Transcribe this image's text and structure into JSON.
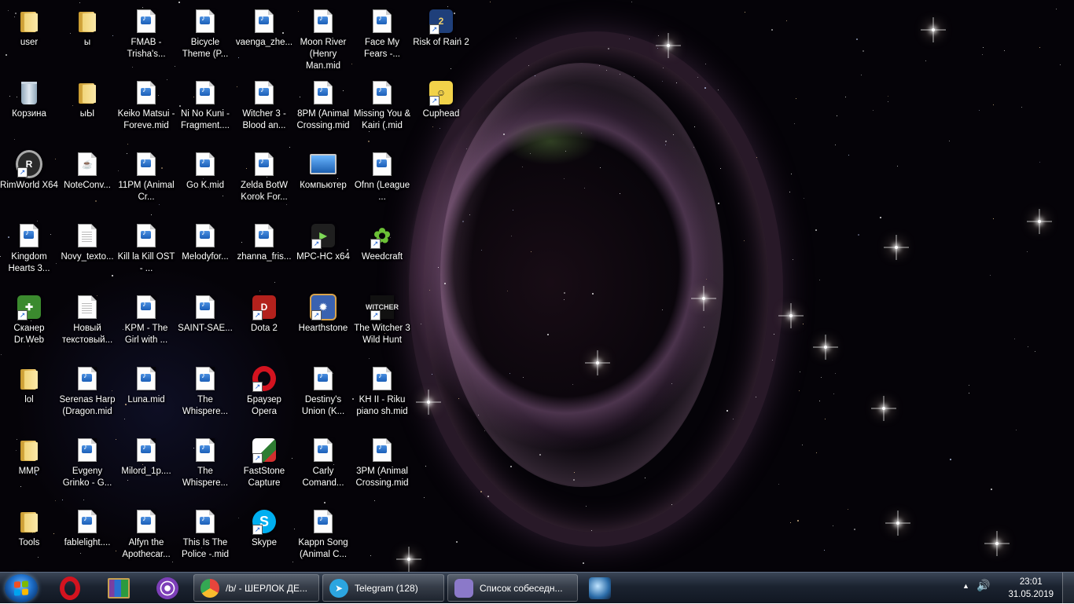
{
  "desktop": {
    "icons": [
      {
        "label": "user",
        "kind": "folder-user"
      },
      {
        "label": "ы",
        "kind": "folder"
      },
      {
        "label": "FMAB - Trisha's...",
        "kind": "mid"
      },
      {
        "label": "Bicycle Theme (P...",
        "kind": "mid"
      },
      {
        "label": "vaenga_zhe...",
        "kind": "mid"
      },
      {
        "label": "Moon River (Henry Man.mid",
        "kind": "mid"
      },
      {
        "label": "Face My Fears -...",
        "kind": "mid"
      },
      {
        "label": "Risk of Rain 2",
        "kind": "app-ror2"
      },
      {
        "label": "Корзина",
        "kind": "recycle-bin"
      },
      {
        "label": "ыЫ",
        "kind": "folder"
      },
      {
        "label": "Keiko Matsui - Foreve.mid",
        "kind": "mid"
      },
      {
        "label": "Ni No Kuni - Fragment....",
        "kind": "mid"
      },
      {
        "label": "Witcher 3 - Blood an...",
        "kind": "mid"
      },
      {
        "label": "8PM (Animal Crossing.mid",
        "kind": "mid"
      },
      {
        "label": "Missing You & Kairi (.mid",
        "kind": "mid"
      },
      {
        "label": "Cuphead",
        "kind": "app-cuphead"
      },
      {
        "label": "RimWorld X64",
        "kind": "app-rimworld"
      },
      {
        "label": "NoteConv...",
        "kind": "java"
      },
      {
        "label": "11PM (Animal Cr...",
        "kind": "mid"
      },
      {
        "label": "Go K.mid",
        "kind": "mid"
      },
      {
        "label": "Zelda BotW Korok For...",
        "kind": "mid"
      },
      {
        "label": "Компьютер",
        "kind": "computer"
      },
      {
        "label": "Ofnn (League ...",
        "kind": "mid"
      },
      {
        "label": "",
        "kind": "none"
      },
      {
        "label": "Kingdom Hearts 3...",
        "kind": "mid"
      },
      {
        "label": "Novy_texto...",
        "kind": "txt"
      },
      {
        "label": "Kill la Kill OST - ...",
        "kind": "mid"
      },
      {
        "label": "Melodyfor...",
        "kind": "mid"
      },
      {
        "label": "zhanna_fris...",
        "kind": "mid"
      },
      {
        "label": "MPC-HC x64",
        "kind": "app-mpc"
      },
      {
        "label": "Weedcraft",
        "kind": "app-weedcraft"
      },
      {
        "label": "",
        "kind": "none"
      },
      {
        "label": "Сканер Dr.Web",
        "kind": "app-drweb"
      },
      {
        "label": "Новый текстовый...",
        "kind": "txt"
      },
      {
        "label": "KPM - The Girl with ...",
        "kind": "mid"
      },
      {
        "label": "SAINT-SAE...",
        "kind": "mid"
      },
      {
        "label": "Dota 2",
        "kind": "app-dota"
      },
      {
        "label": "Hearthstone",
        "kind": "app-hearthstone"
      },
      {
        "label": "The Witcher 3 Wild Hunt",
        "kind": "app-witcher"
      },
      {
        "label": "",
        "kind": "none"
      },
      {
        "label": "lol",
        "kind": "folder"
      },
      {
        "label": "Serenas Harp (Dragon.mid",
        "kind": "mid"
      },
      {
        "label": "Luna.mid",
        "kind": "mid"
      },
      {
        "label": "The Whispere...",
        "kind": "mid"
      },
      {
        "label": "Браузер Opera",
        "kind": "app-opera"
      },
      {
        "label": "Destiny's Union (K...",
        "kind": "mid"
      },
      {
        "label": "KH II - Riku piano sh.mid",
        "kind": "mid"
      },
      {
        "label": "",
        "kind": "none"
      },
      {
        "label": "MMP",
        "kind": "folder"
      },
      {
        "label": "Evgeny Grinko - G...",
        "kind": "mid"
      },
      {
        "label": "Milord_1p....",
        "kind": "mid"
      },
      {
        "label": "The Whispere...",
        "kind": "mid"
      },
      {
        "label": "FastStone Capture",
        "kind": "app-faststone"
      },
      {
        "label": "Carly Comand...",
        "kind": "mid"
      },
      {
        "label": "3PM (Animal Crossing.mid",
        "kind": "mid"
      },
      {
        "label": "",
        "kind": "none"
      },
      {
        "label": "Tools",
        "kind": "folder"
      },
      {
        "label": "fablelight....",
        "kind": "mid"
      },
      {
        "label": "Alfyn the Apothecar...",
        "kind": "mid"
      },
      {
        "label": "This Is The Police -.mid",
        "kind": "mid"
      },
      {
        "label": "Skype",
        "kind": "app-skype"
      },
      {
        "label": "Kappn Song (Animal C...",
        "kind": "mid"
      },
      {
        "label": "",
        "kind": "none"
      },
      {
        "label": "",
        "kind": "none"
      }
    ]
  },
  "taskbar": {
    "start_icon": "windows-start-orb",
    "pinned": [
      {
        "name": "opera-taskbar-icon",
        "color": "#d3131f"
      },
      {
        "name": "winrar-taskbar-icon",
        "color": "#7a3fa0"
      },
      {
        "name": "tor-browser-taskbar-icon",
        "color": "#7d3fb8"
      }
    ],
    "tasks": [
      {
        "name": "chrome-task",
        "label": "/b/ - ШЕРЛОК ДЕ...",
        "color": "#e8453c"
      },
      {
        "name": "telegram-task",
        "label": "Telegram (128)",
        "color": "#2ca5e0",
        "badge": "128"
      },
      {
        "name": "pidgin-task",
        "label": "Список собеседн...",
        "color": "#8b79c9"
      }
    ],
    "extra_icon": "steam-like-taskbar-icon",
    "tray": {
      "up_arrow": "▲",
      "volume_icon": "🔊",
      "time": "23:01",
      "date": "31.05.2019"
    }
  }
}
